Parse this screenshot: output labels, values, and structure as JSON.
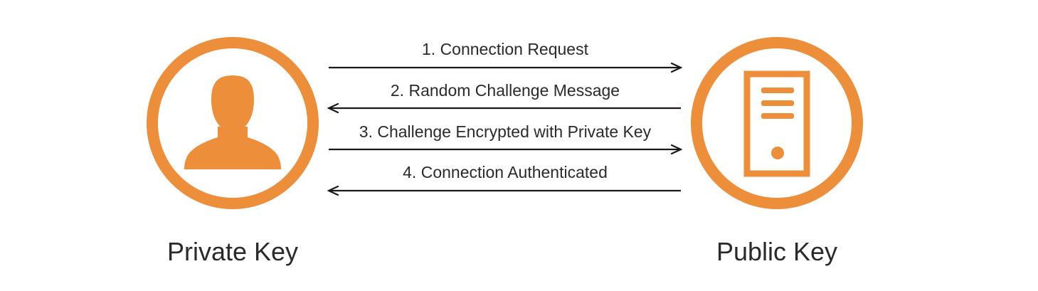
{
  "accent_color": "#ED8E3A",
  "text_color": "#2a2a2a",
  "nodes": {
    "client": {
      "label": "Private Key",
      "icon": "user-icon"
    },
    "server": {
      "label": "Public Key",
      "icon": "server-icon"
    }
  },
  "steps": [
    {
      "label": "1. Connection Request",
      "direction": "right"
    },
    {
      "label": "2. Random Challenge Message",
      "direction": "left"
    },
    {
      "label": "3. Challenge Encrypted with Private Key",
      "direction": "right"
    },
    {
      "label": "4. Connection Authenticated",
      "direction": "left"
    }
  ]
}
